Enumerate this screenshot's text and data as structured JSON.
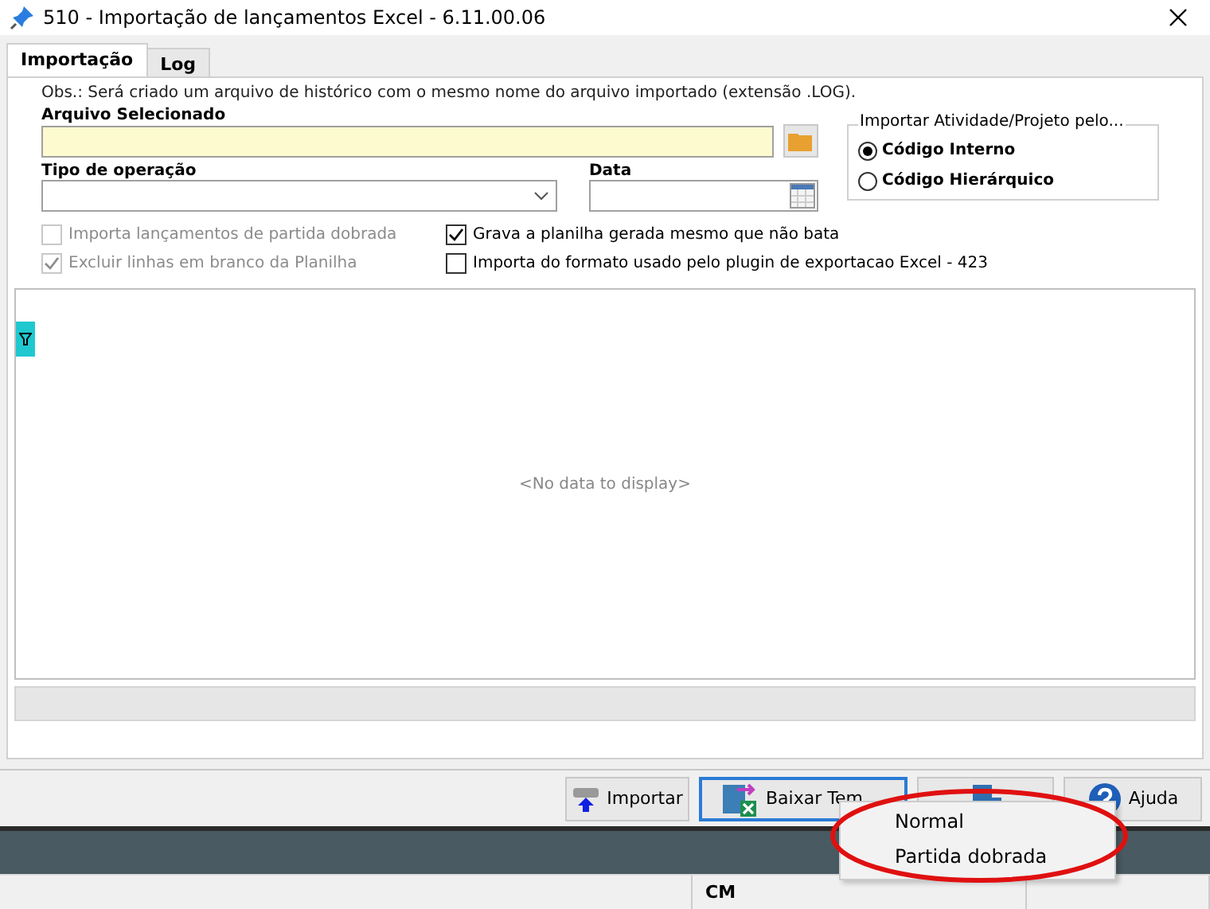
{
  "window": {
    "title": "510 - Importação de lançamentos Excel - 6.11.00.06"
  },
  "tabs": [
    {
      "label": "Importação",
      "selected": true
    },
    {
      "label": "Log",
      "selected": false
    }
  ],
  "note": "Obs.: Será criado um arquivo de histórico com o mesmo nome do arquivo importado (extensão .LOG).",
  "file_field": {
    "label": "Arquivo Selecionado"
  },
  "operation_field": {
    "label": "Tipo de operação"
  },
  "date_field": {
    "label": "Data"
  },
  "import_by": {
    "title": "Importar Atividade/Projeto pelo...",
    "options": [
      {
        "label": "Código Interno",
        "selected": true
      },
      {
        "label": "Código Hierárquico",
        "selected": false
      }
    ]
  },
  "checkboxes": [
    {
      "label": "Importa lançamentos de partida dobrada",
      "checked": false,
      "disabled": true
    },
    {
      "label": "Excluir linhas em branco da Planilha",
      "checked": true,
      "disabled": true
    },
    {
      "label": "Grava a planilha gerada mesmo que não bata",
      "checked": true,
      "disabled": false
    },
    {
      "label": "Importa do formato usado pelo plugin de exportacao Excel - 423",
      "checked": false,
      "disabled": false
    }
  ],
  "grid": {
    "empty_text": "<No data to display>"
  },
  "buttons": [
    {
      "kind": "import",
      "label": "Importar",
      "focused": false
    },
    {
      "kind": "template",
      "label": "Baixar Tem",
      "focused": true
    },
    {
      "kind": "exit",
      "focused": false
    },
    {
      "kind": "help",
      "label": "Ajuda",
      "focused": false
    }
  ],
  "menu": {
    "items": [
      "Normal",
      "Partida dobrada"
    ]
  },
  "status_bar": {
    "cells": [
      "",
      "CM",
      ""
    ]
  }
}
